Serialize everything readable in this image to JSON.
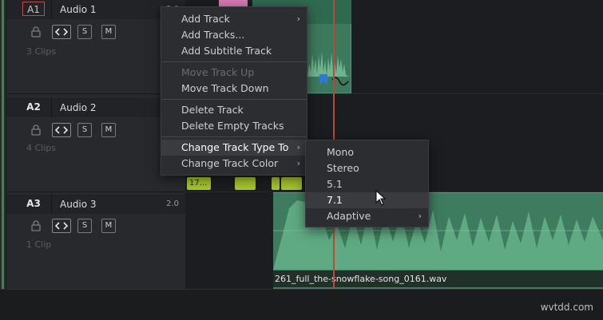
{
  "colors": {
    "accent_selected": "#c94848",
    "playhead": "#b84a36",
    "clip_green": "#3f7c5f",
    "clip_yellow": "#a4c52e",
    "clip_pink": "#d77ab2",
    "marker_blue": "#2b7bd8"
  },
  "tracks": [
    {
      "id": "A1",
      "name": "Audio 1",
      "volume": "2.0",
      "selected": true,
      "clips_label": "3 Clips",
      "buttons": {
        "solo": "S",
        "mute": "M"
      },
      "icons": [
        "lock-icon",
        "link-icon"
      ]
    },
    {
      "id": "A2",
      "name": "Audio 2",
      "volume": "",
      "selected": false,
      "clips_label": "4 Clips",
      "buttons": {
        "solo": "S",
        "mute": "M"
      },
      "icons": [
        "lock-icon",
        "link-icon"
      ]
    },
    {
      "id": "A3",
      "name": "Audio 3",
      "volume": "2.0",
      "selected": false,
      "clips_label": "1 Clip",
      "buttons": {
        "solo": "S",
        "mute": "M"
      },
      "icons": [
        "lock-icon",
        "link-icon"
      ]
    }
  ],
  "timeline": {
    "yellow_clip_label": "17...",
    "a3_clip_name": "261_full_the-snowflake-song_0161.wav"
  },
  "context_menu": {
    "items": [
      {
        "label": "Add Track",
        "submenu": true,
        "disabled": false
      },
      {
        "label": "Add Tracks...",
        "submenu": false,
        "disabled": false
      },
      {
        "label": "Add Subtitle Track",
        "submenu": false,
        "disabled": false
      },
      {
        "label": "Move Track Up",
        "submenu": false,
        "disabled": true
      },
      {
        "label": "Move Track Down",
        "submenu": false,
        "disabled": false
      },
      {
        "label": "Delete Track",
        "submenu": false,
        "disabled": false
      },
      {
        "label": "Delete Empty Tracks",
        "submenu": false,
        "disabled": false
      },
      {
        "label": "Change Track Type To",
        "submenu": true,
        "disabled": false,
        "active": true
      },
      {
        "label": "Change Track Color",
        "submenu": true,
        "disabled": false
      }
    ],
    "arrow_glyph": "›"
  },
  "track_type_submenu": {
    "items": [
      {
        "label": "Mono",
        "submenu": false
      },
      {
        "label": "Stereo",
        "submenu": false
      },
      {
        "label": "5.1",
        "submenu": false
      },
      {
        "label": "7.1",
        "submenu": false,
        "hovered": true
      },
      {
        "label": "Adaptive",
        "submenu": true
      }
    ]
  },
  "watermark": "wvtdd.com"
}
